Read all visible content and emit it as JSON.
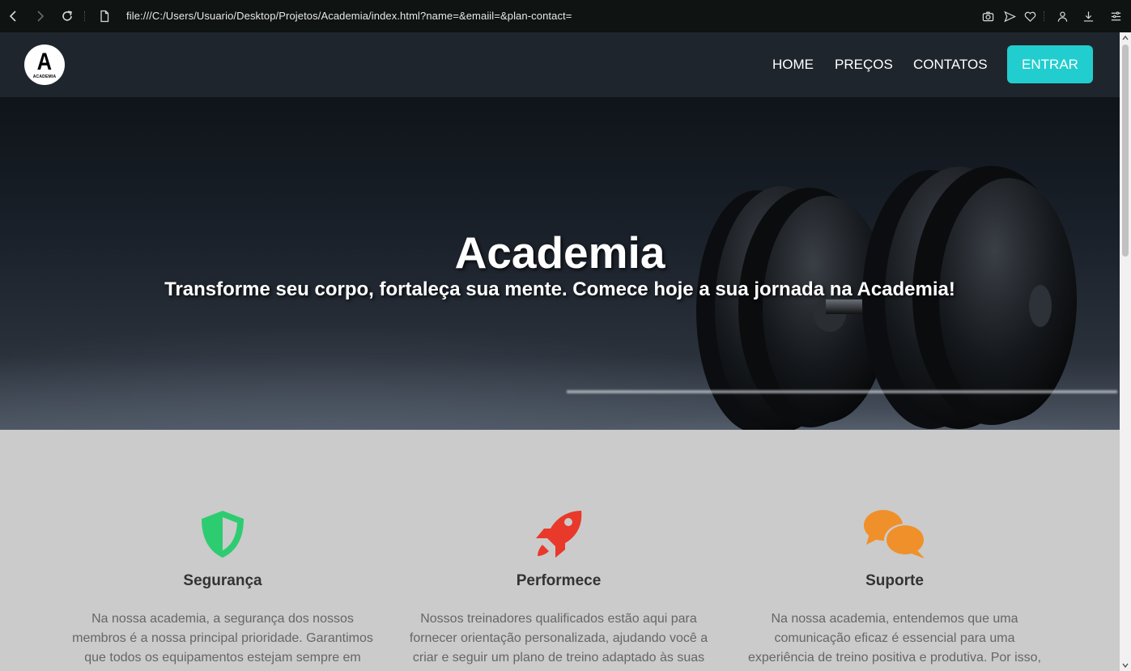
{
  "browser": {
    "url": "file:///C:/Users/Usuario/Desktop/Projetos/Academia/index.html?name=&emaiil=&plan-contact="
  },
  "header": {
    "logo_letter": "A",
    "logo_sub": "ACADEMIA",
    "menu": [
      "HOME",
      "PREÇOS",
      "CONTATOS"
    ],
    "enter_label": "ENTRAR",
    "enter_color": "#22cdcf",
    "background": "#1f252c"
  },
  "hero": {
    "title": "Academia",
    "subtitle": "Transforme seu corpo, fortaleça sua mente. Comece hoje a sua jornada na Academia!"
  },
  "features": [
    {
      "icon": "shield-icon",
      "color": "#2ecc71",
      "title": "Segurança",
      "text": "Na nossa academia, a segurança dos nossos membros é a nossa principal prioridade. Garantimos que todos os equipamentos estejam sempre em"
    },
    {
      "icon": "rocket-icon",
      "color": "#e8392b",
      "title": "Performece",
      "text": "Nossos treinadores qualificados estão aqui para fornecer orientação personalizada, ajudando você a criar e seguir um plano de treino adaptado às suas"
    },
    {
      "icon": "chat-bubbles-icon",
      "color": "#f0902a",
      "title": "Suporte",
      "text": "Na nossa academia, entendemos que uma comunicação eficaz é essencial para uma experiência de treino positiva e produtiva. Por isso,"
    }
  ]
}
